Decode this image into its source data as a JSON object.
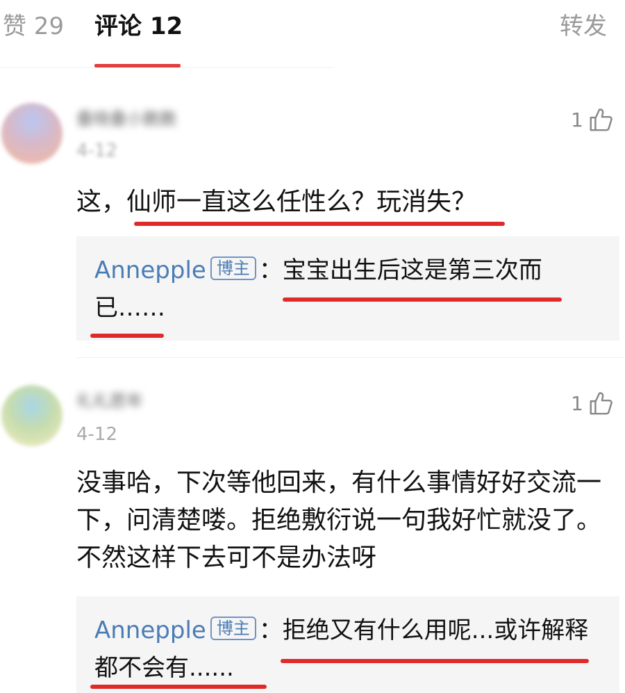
{
  "tabs": {
    "likes": "赞 29",
    "comments": "评论 12",
    "repost": "转发"
  },
  "comments": [
    {
      "username": "叠晓叠小脆脆",
      "date": "4-12",
      "likes": "1",
      "body": "这，仙师一直这么任性么？玩消失？",
      "reply": {
        "author": "Annepple",
        "badge": "博主",
        "text": "：宝宝出生后这是第三次而已……"
      }
    },
    {
      "username": "礼礼愿年",
      "date": "4-12",
      "likes": "1",
      "body": "没事哈，下次等他回来，有什么事情好好交流一下，问清楚喽。拒绝敷衍说一句我好忙就没了。不然这样下去可不是办法呀",
      "reply": {
        "author": "Annepple",
        "badge": "博主",
        "text": "：拒绝又有什么用呢...或许解释都不会有......"
      }
    }
  ],
  "colors": {
    "accent": "#e23c3c",
    "annotation": "#e02a2a",
    "link": "#4a7cb5",
    "muted": "#9a9a9a"
  }
}
